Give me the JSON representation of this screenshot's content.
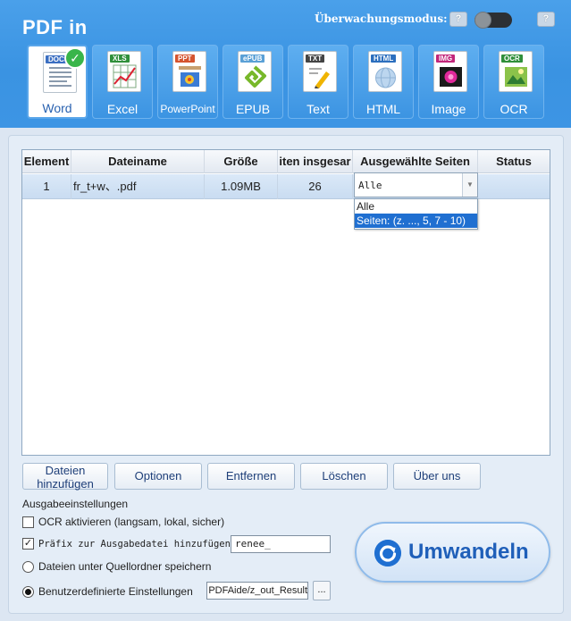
{
  "header": {
    "title": "PDF in",
    "monitor_label": "Überwachungsmodus:",
    "help_label": "?",
    "tabs": [
      {
        "label": "Word",
        "tag": "DOC",
        "color": "#3b6fc2"
      },
      {
        "label": "Excel",
        "tag": "XLS",
        "color": "#2f8f3a"
      },
      {
        "label": "PowerPoint",
        "tag": "PPT",
        "color": "#d5542f"
      },
      {
        "label": "EPUB",
        "tag": "ePUB",
        "color": "#5aa0d6"
      },
      {
        "label": "Text",
        "tag": "TXT",
        "color": "#444444"
      },
      {
        "label": "HTML",
        "tag": "HTML",
        "color": "#2c6fbe"
      },
      {
        "label": "Image",
        "tag": "IMG",
        "color": "#c2267a"
      },
      {
        "label": "OCR",
        "tag": "OCR",
        "color": "#2f8f3a"
      }
    ]
  },
  "table": {
    "columns": [
      "Element",
      "Dateiname",
      "Größe",
      "iten insgesar",
      "Ausgewählte Seiten",
      "Status"
    ],
    "rows": [
      {
        "index": "1",
        "filename": "fr_t+w、.pdf",
        "size": "1.09MB",
        "pages": "26",
        "selected": "Alle",
        "status": ""
      }
    ],
    "dropdown_options": [
      "Alle",
      "Seiten: (z. ..., 5, 7 - 10)"
    ]
  },
  "buttons": {
    "add_files_line1": "Dateien",
    "add_files_line2": "hinzufügen",
    "options": "Optionen",
    "remove": "Entfernen",
    "delete": "Löschen",
    "about": "Über uns"
  },
  "output": {
    "title": "Ausgabeeinstellungen",
    "ocr_label": "OCR aktivieren (langsam, lokal, sicher)",
    "prefix_label": "Präfix zur Ausgabedatei hinzufügen",
    "prefix_value": "renee_",
    "source_folder_label": "Dateien unter Quellordner speichern",
    "custom_label": "Benutzerdefinierte Einstellungen",
    "custom_path": "PDFAide/z_out_Result",
    "browse_label": "..."
  },
  "convert": {
    "label": "Umwandeln"
  }
}
